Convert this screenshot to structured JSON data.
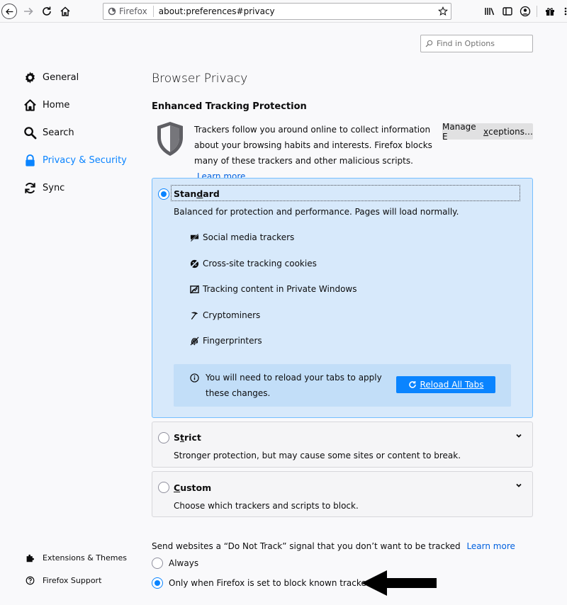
{
  "toolbar": {
    "identity_label": "Firefox",
    "url": "about:preferences#privacy"
  },
  "search": {
    "placeholder": "Find in Options"
  },
  "sidebar": {
    "items": [
      {
        "label": "General",
        "icon": "gear-icon"
      },
      {
        "label": "Home",
        "icon": "home-icon"
      },
      {
        "label": "Search",
        "icon": "search-icon"
      },
      {
        "label": "Privacy & Security",
        "icon": "lock-icon",
        "selected": true
      },
      {
        "label": "Sync",
        "icon": "sync-icon"
      }
    ],
    "footer": [
      {
        "label": "Extensions & Themes",
        "icon": "puzzle-icon"
      },
      {
        "label": "Firefox Support",
        "icon": "help-icon"
      }
    ]
  },
  "main": {
    "title": "Browser Privacy",
    "etp": {
      "heading": "Enhanced Tracking Protection",
      "description": "Trackers follow you around online to collect information about your browsing habits and interests. Firefox blocks many of these trackers and other malicious scripts.",
      "learn_more": "Learn more",
      "manage_pre": "Manage E",
      "manage_ul": "x",
      "manage_post": "ceptions…"
    },
    "standard": {
      "title_pre": "Stan",
      "title_ul": "d",
      "title_post": "ard",
      "description": "Balanced for protection and performance. Pages will load normally.",
      "trackers": [
        {
          "label": "Social media trackers",
          "icon": "social-tracker-icon"
        },
        {
          "label": "Cross-site tracking cookies",
          "icon": "cookie-icon"
        },
        {
          "label": "Tracking content in Private Windows",
          "icon": "tracking-content-icon"
        },
        {
          "label": "Cryptominers",
          "icon": "cryptominer-icon"
        },
        {
          "label": "Fingerprinters",
          "icon": "fingerprint-icon"
        }
      ],
      "reload_text": "You will need to reload your tabs to apply these changes.",
      "reload_button": "Reload All Tabs"
    },
    "strict": {
      "title_pre": "S",
      "title_ul": "t",
      "title_post": "rict",
      "description": "Stronger protection, but may cause some sites or content to break."
    },
    "custom": {
      "title_pre": "",
      "title_ul": "C",
      "title_post": "ustom",
      "description": "Choose which trackers and scripts to block."
    },
    "dnt": {
      "label": "Send websites a “Do Not Track” signal that you don’t want to be tracked",
      "learn_more": "Learn more",
      "options": [
        {
          "label": "Always",
          "selected": false
        },
        {
          "label": "Only when Firefox is set to block known trackers",
          "selected": true
        }
      ]
    }
  },
  "colors": {
    "accent": "#0a84ff",
    "link": "#0060df",
    "selected_card": "#d7e9fb"
  }
}
